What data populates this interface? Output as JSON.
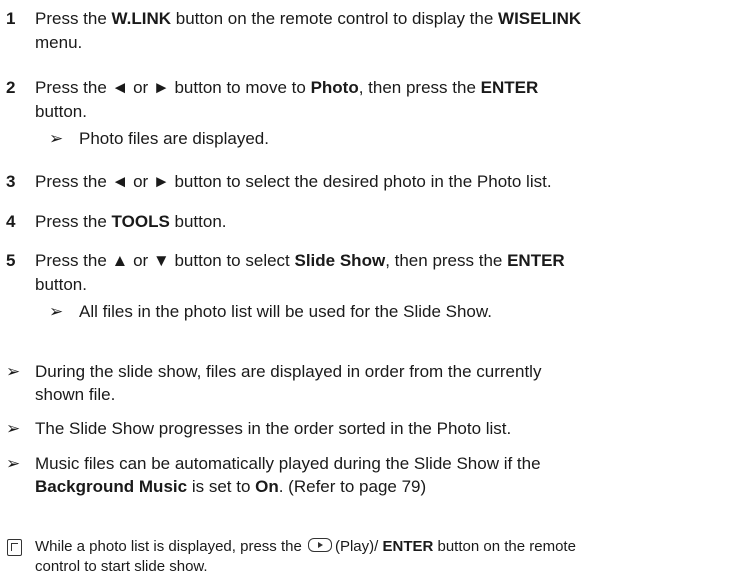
{
  "steps": [
    {
      "num": "1",
      "line1": [
        "Press the ",
        {
          "b": "W.LINK"
        },
        " button on the remote control to display the ",
        {
          "b": "WISELINK"
        }
      ],
      "line2": "menu."
    },
    {
      "num": "2",
      "line1": [
        "Press the ◄ or ► button to move to ",
        {
          "b": "Photo"
        },
        ", then press the ",
        {
          "b": "ENTER"
        }
      ],
      "line2": "button.",
      "sub": "Photo files are displayed."
    },
    {
      "num": "3",
      "line1": [
        "Press the ◄ or ► button to select the desired photo in the Photo list."
      ]
    },
    {
      "num": "4",
      "line1": [
        "Press the ",
        {
          "b": "TOOLS"
        },
        " button."
      ]
    },
    {
      "num": "5",
      "line1": [
        "Press the ▲ or ▼ button to select ",
        {
          "b": "Slide Show"
        },
        ", then press the ",
        {
          "b": "ENTER"
        }
      ],
      "line2": "button.",
      "sub": "All files in the photo list will be used for the Slide Show."
    }
  ],
  "arrow_symbol": "➢",
  "notes": [
    {
      "line1": "During the slide show, files are displayed in order from the currently",
      "line2": "shown file."
    },
    {
      "line1": "The Slide Show progresses in the order sorted in the Photo list."
    },
    {
      "line1": "Music files can be automatically played during the Slide Show if the",
      "line2": [
        "",
        {
          "b": "Background Music"
        },
        " is set to ",
        {
          "b": "On"
        },
        ". (Refer to page 79)"
      ]
    }
  ],
  "memo": {
    "before": "While a photo list is displayed, press the ",
    "play_label": "(Play)/ ",
    "enter": "ENTER",
    "after": " button on the remote",
    "line2": "control to start slide show."
  }
}
